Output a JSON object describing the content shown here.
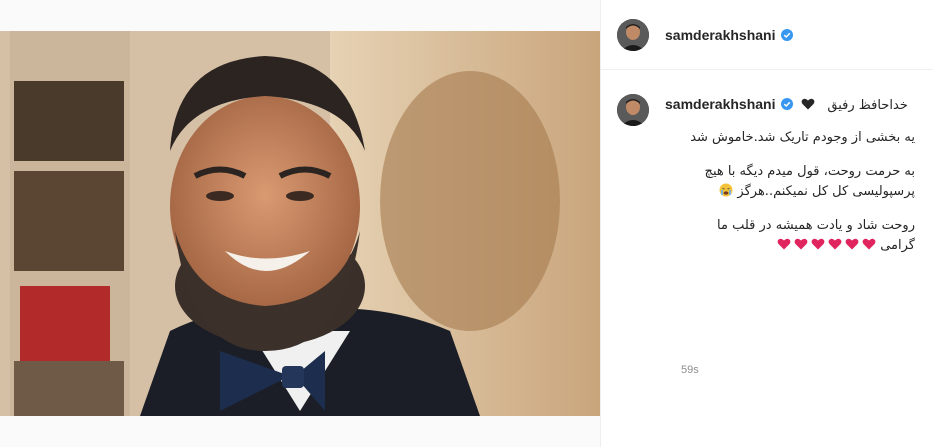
{
  "post": {
    "username": "samderakhshani",
    "image_alt": "photo"
  },
  "caption": {
    "username": "samderakhshani",
    "line1": "خداحافظ رفیق",
    "line2": "یه بخشی از وجودم تاریک شد.خاموش شد",
    "line3": "به حرمت روحت، قول میدم دیگه با هیچ",
    "line4": "پرسپولیسی کل کل نمیکنم..هرگز",
    "line5": "روحت شاد و یادت همیشه در قلب ما",
    "line6": "گرامی",
    "hearts_count": 6,
    "time": "59s"
  },
  "colors": {
    "verified": "#3897f0",
    "heart_red": "#e0245e",
    "heart_black": "#262626"
  }
}
